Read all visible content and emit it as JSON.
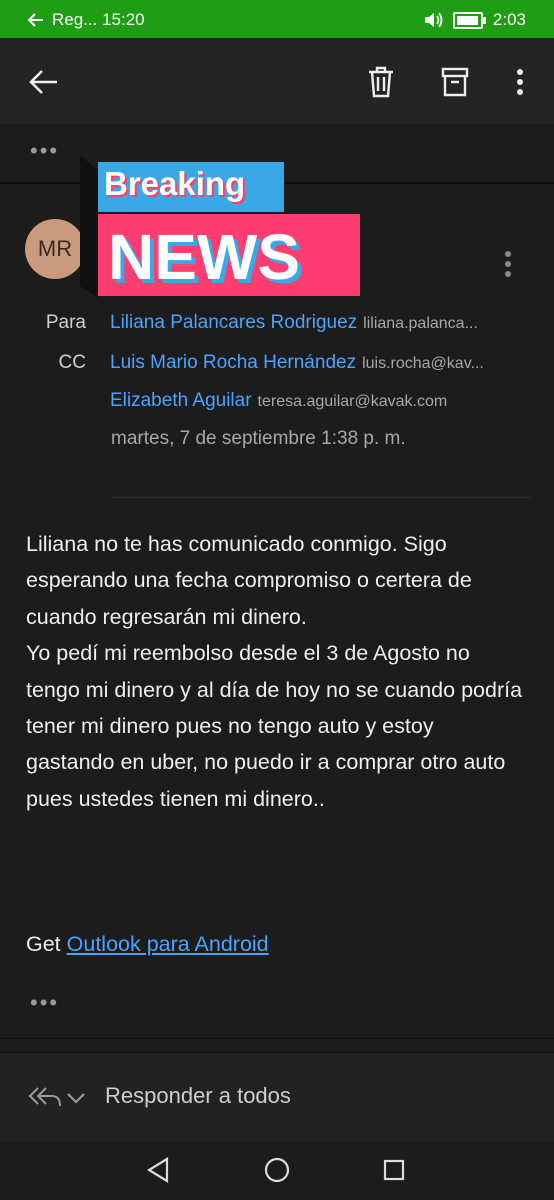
{
  "status_bar": {
    "left_text": "Reg... 15:20",
    "time": "2:03",
    "battery_level": 0.95,
    "color": "#1f9e15"
  },
  "toolbar": {
    "back_icon": "arrow-left-icon",
    "delete_icon": "trash-icon",
    "archive_icon": "archive-icon",
    "more_icon": "more-vertical-icon"
  },
  "collapsed_thread": {
    "ellipsis": "•••"
  },
  "sticker": {
    "line1": "Breaking",
    "line2": "NEWS",
    "colors": {
      "blue": "#3aa7e6",
      "pink": "#ff3d6e"
    }
  },
  "message": {
    "sender_initials": "MR",
    "to_label": "Para",
    "to": [
      {
        "name": "Liliana Palancares Rodriguez",
        "email": "liliana.palanca..."
      }
    ],
    "cc_label": "CC",
    "cc": [
      {
        "name": "Luis Mario Rocha Hernández",
        "email": "luis.rocha@kav..."
      },
      {
        "name": "Elizabeth Aguilar",
        "email": "teresa.aguilar@kavak.com"
      }
    ],
    "date": "martes, 7 de septiembre 1:38 p. m.",
    "body": [
      "Liliana no te has comunicado conmigo. Sigo esperando una fecha compromiso o certera de cuando regresarán mi dinero.",
      "Yo pedí mi reembolso desde el 3 de Agosto no tengo mi dinero y al día de hoy no se cuando podría tener mi dinero pues no tengo auto y estoy gastando en uber, no puedo ir a comprar otro auto pues ustedes tienen mi dinero.."
    ],
    "footer_prefix": "Get ",
    "footer_link": "Outlook para Android",
    "trailing_ellipsis": "•••"
  },
  "reply_bar": {
    "label": "Responder a todos",
    "icon": "reply-all-icon"
  },
  "nav_bar": {
    "back": "nav-back-icon",
    "home": "nav-home-icon",
    "recents": "nav-recents-icon"
  }
}
